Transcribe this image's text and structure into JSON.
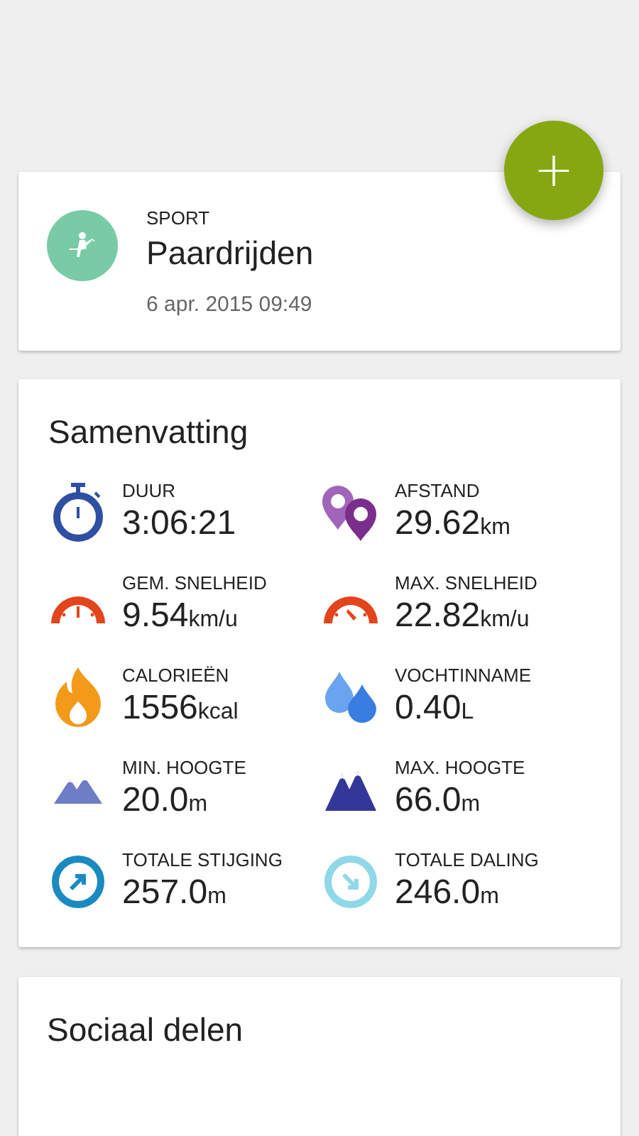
{
  "fab": {
    "label": "+"
  },
  "activity": {
    "category": "SPORT",
    "name": "Paardrijden",
    "datetime": "6 apr. 2015 09:49"
  },
  "summary": {
    "title": "Samenvatting",
    "stats": [
      {
        "kind": "duration",
        "label": "DUUR",
        "value": "3:06:21"
      },
      {
        "kind": "distance",
        "label": "AFSTAND",
        "value": "29.62",
        "unit": "km"
      },
      {
        "kind": "avg-speed",
        "label": "GEM. SNELHEID",
        "value": "9.54",
        "unit": "km/u"
      },
      {
        "kind": "max-speed",
        "label": "MAX. SNELHEID",
        "value": "22.82",
        "unit": "km/u"
      },
      {
        "kind": "calories",
        "label": "CALORIEËN",
        "value": "1556",
        "unit": "kcal"
      },
      {
        "kind": "hydration",
        "label": "VOCHTINNAME",
        "value": "0.40",
        "unit": "L"
      },
      {
        "kind": "min-altitude",
        "label": "MIN. HOOGTE",
        "value": "20.0",
        "unit": "m"
      },
      {
        "kind": "max-altitude",
        "label": "MAX. HOOGTE",
        "value": "66.0",
        "unit": "m"
      },
      {
        "kind": "ascent",
        "label": "TOTALE STIJGING",
        "value": "257.0",
        "unit": "m"
      },
      {
        "kind": "descent",
        "label": "TOTALE DALING",
        "value": "246.0",
        "unit": "m"
      }
    ]
  },
  "social": {
    "title": "Sociaal delen"
  }
}
